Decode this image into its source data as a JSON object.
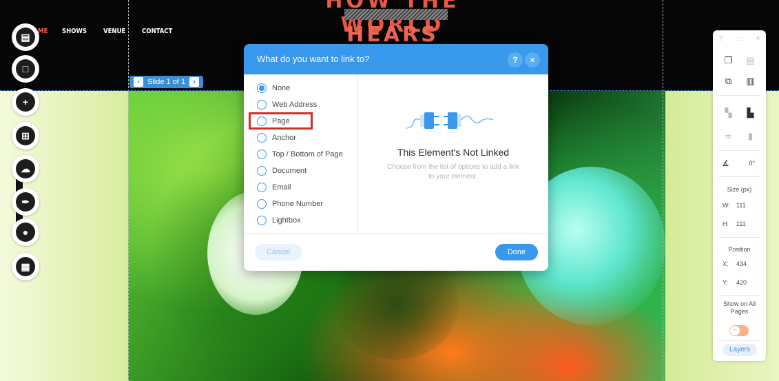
{
  "site": {
    "title_line1": "HOW THE WORLD",
    "title_line2": "HEARS",
    "nav": [
      "ME",
      "SHOWS",
      "VENUE",
      "CONTACT"
    ]
  },
  "slide_tag": {
    "label": "Slide 1 of 1",
    "prev_icon": "chevron-left-icon",
    "next_icon": "chevron-right-icon"
  },
  "left_toolbar": {
    "items": [
      {
        "name": "pages-menu",
        "icon": "page-icon",
        "glyph": "▤"
      },
      {
        "name": "background",
        "icon": "square-icon",
        "glyph": "□"
      },
      {
        "name": "add",
        "icon": "plus-icon",
        "glyph": "+"
      },
      {
        "name": "add-apps",
        "icon": "apps-icon",
        "glyph": "⊞"
      },
      {
        "name": "upload",
        "icon": "cloud-upload-icon",
        "glyph": "☁"
      },
      {
        "name": "blog",
        "icon": "pen-icon",
        "glyph": "✒"
      },
      {
        "name": "chat",
        "icon": "chat-icon",
        "glyph": "💬"
      },
      {
        "name": "bookings",
        "icon": "calendar-icon",
        "glyph": "▦"
      }
    ]
  },
  "dialog": {
    "title": "What do you want to link to?",
    "help_label": "?",
    "close_label": "×",
    "options": [
      "None",
      "Web Address",
      "Page",
      "Anchor",
      "Top / Bottom of Page",
      "Document",
      "Email",
      "Phone Number",
      "Lightbox"
    ],
    "selected_option": "None",
    "highlighted_option": "Page",
    "illustration_icon": "unplugged-icon",
    "empty_title": "This Element's Not Linked",
    "empty_desc": "Choose from the list of options to add a link to your element.",
    "cancel_label": "Cancel",
    "done_label": "Done"
  },
  "right_panel": {
    "header": {
      "help": "?",
      "drag": "::::",
      "close": "×"
    },
    "size_label": "Size (px)",
    "w_label": "W:",
    "w_value": "111",
    "h_label": "H:",
    "h_value": "111",
    "rotation_value": "0°",
    "position_label": "Position",
    "x_label": "X:",
    "x_value": "434",
    "y_label": "Y:",
    "y_value": "420",
    "show_all_label": "Show on All Pages",
    "toggle_knob": "−",
    "layers_label": "Layers"
  },
  "colors": {
    "accent": "#3899ec",
    "title_red": "#f0604d",
    "highlight_red": "#d62b1f",
    "toggle_orange": "#fcb283"
  }
}
